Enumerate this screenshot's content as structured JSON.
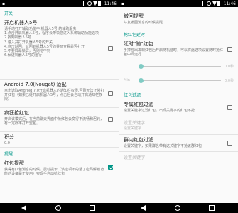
{
  "status_bar": {
    "time": "11:46"
  },
  "left": {
    "category_switch": "开关",
    "prefs": [
      {
        "title": "开启机器人5号",
        "summary": "请手动打开辅助功能中 机器人5号 的辅助服务:\n1.点击开启机器人5号，程序会带领您进入系统辅助功能选项\n2.找到机器人5号\n3.进入并打开机器人5号的开关\n4.点击返回，返回到机器人5号的界面查看是否打开\n5.不要屏幕锁屏，否则抢不到\n6.保证机器人5号的运行",
        "checked": false
      },
      {
        "title": "Android 7.0(Nougat) 适配",
        "summary": "点击选取Android 7.0开启机器人的通知栏权限,否则无法正常打开红包（如果已经开启机器人5号，点击后会自动开启通知栏权限）",
        "checked": false
      },
      {
        "title": "疯狂抢红包",
        "summary": "开启该模式后，在当前聊天界面中抢红包会变得不流畅和迟钝，有一定概率打开空包。",
        "checked": false
      },
      {
        "title": "积分",
        "summary": "0.0",
        "checked": null
      }
    ],
    "category_remind": "提醒",
    "remind_pref": {
      "title": "红包提醒",
      "summary": "获得有红包消息的时候，震动提示（该选项不的适了密码解锁功能的设备是正使用）实现手自动抢红包",
      "checked": true
    }
  },
  "right": {
    "prefs_top": [
      {
        "title": "撤回提醒",
        "summary": "好友撤回消息的时候提醒"
      }
    ],
    "category_delay": "抢红包延时",
    "delay_pref": {
      "title": "延时\"随\"红包",
      "summary": "手捧检出发现红包后开启随机延时，可以将此选项设置随时抢红包中间运行",
      "checked": false
    },
    "sliders": [
      {
        "label": "",
        "value": "0.0秒",
        "fraction": 0.0
      },
      {
        "label": "Min",
        "value": "0.0秒",
        "fraction": 0.0
      }
    ],
    "category_filter": "红包过滤",
    "filter_prefs": [
      {
        "title": "专属红包过滤",
        "summary": "设置关键字过滤红包，出现关键字的红包不抢",
        "checked": false
      },
      {
        "title": "设置关键字",
        "summary": "设置关键字",
        "disabled": true
      },
      {
        "title": "群内红包过滤",
        "summary": "设置关键字，如果群名带有这关键字不抢该群红包",
        "checked": false
      },
      {
        "title": "设置关键字",
        "summary": "",
        "disabled": true
      }
    ]
  }
}
